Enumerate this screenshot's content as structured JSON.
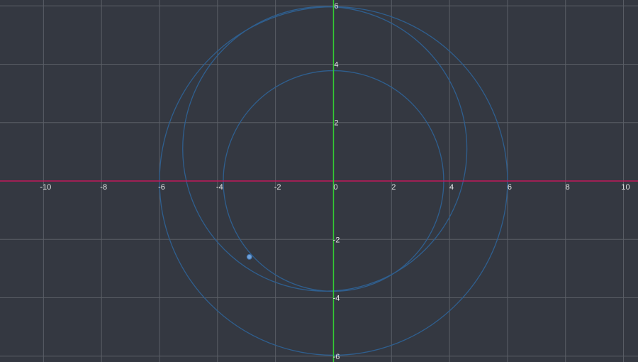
{
  "graph": {
    "x_range": [
      -11.5,
      10.5
    ],
    "y_range": [
      -6.2,
      6.2
    ],
    "grid_step": 2,
    "grid": true,
    "colors": {
      "background": "#343841",
      "grid": "#5a5e66",
      "x_axis": "#c2185b",
      "y_axis": "#33cc33",
      "curve": "#2f5f8f",
      "point": "#6fa0d8"
    },
    "x_tick_labels": [
      "-10",
      "-8",
      "-6",
      "-4",
      "-2",
      "0",
      "2",
      "4",
      "6",
      "8",
      "10"
    ],
    "y_tick_labels": [
      "6",
      "4",
      "2",
      "-2",
      "-4",
      "-6"
    ]
  },
  "chart_data": {
    "type": "scatter",
    "x_ticks": [
      -10,
      -8,
      -6,
      -4,
      -2,
      0,
      2,
      4,
      6,
      8,
      10
    ],
    "y_ticks": [
      6,
      4,
      2,
      -2,
      -4,
      -6
    ],
    "circles": [
      {
        "center": [
          0,
          0
        ],
        "radius": 6
      },
      {
        "center": [
          -0.3,
          1.1
        ],
        "radius": 4.9
      },
      {
        "center": [
          0,
          0
        ],
        "radius": 3.8
      }
    ],
    "points": [
      {
        "x": -2.9,
        "y": -2.6
      }
    ]
  }
}
